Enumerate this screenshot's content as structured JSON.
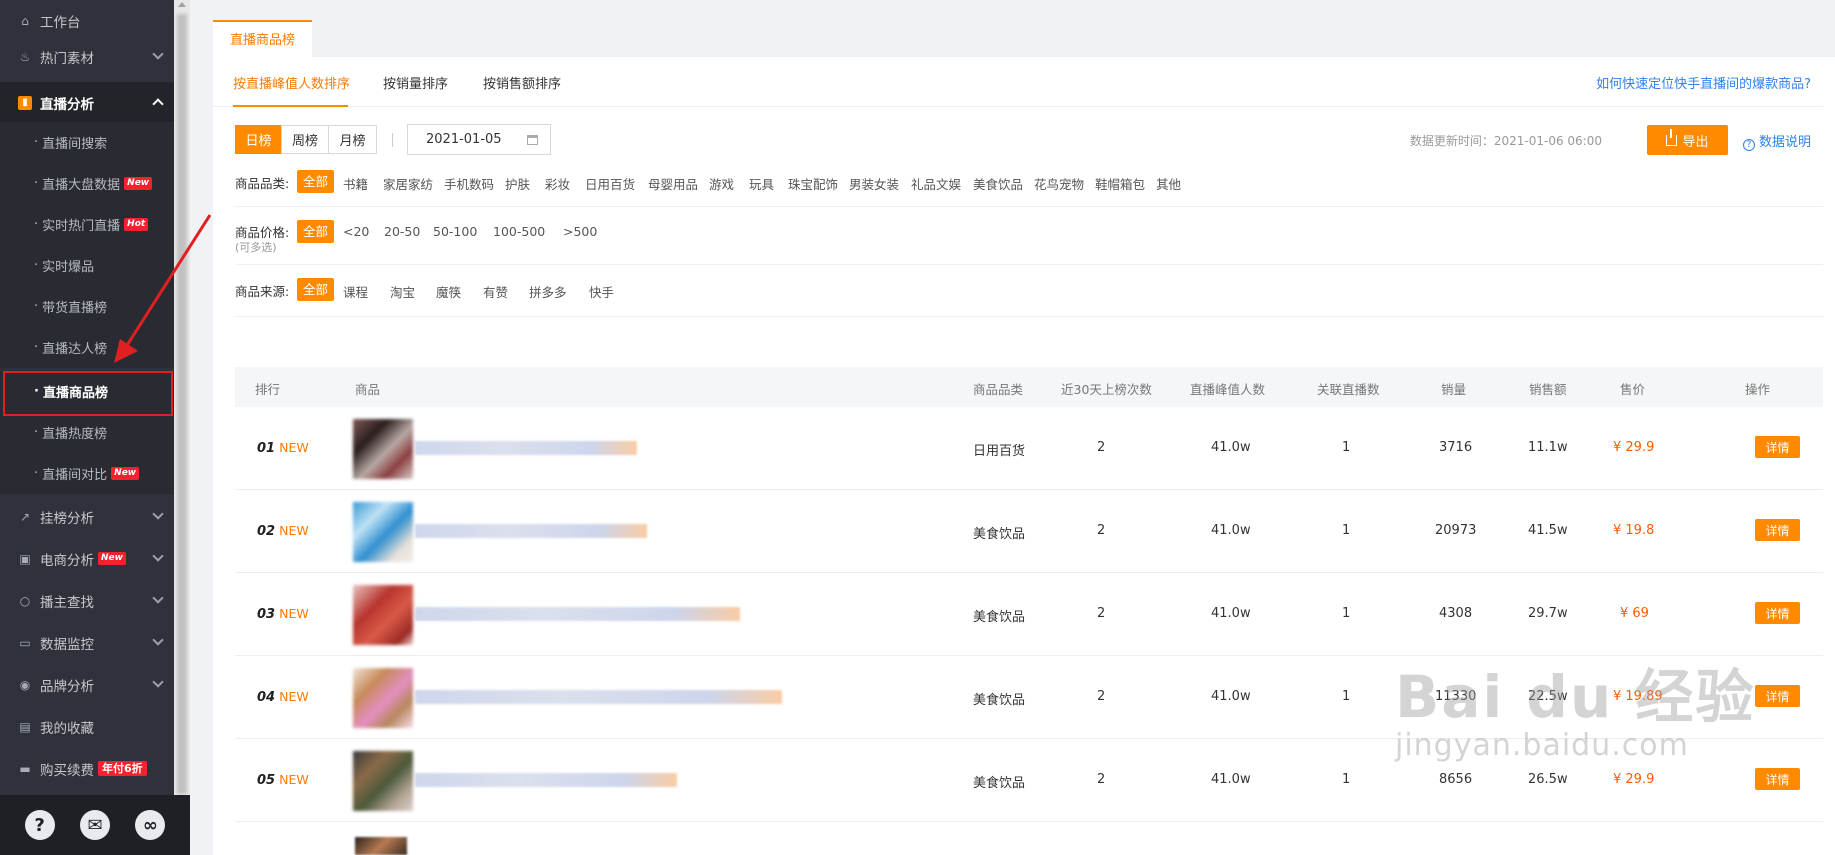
{
  "sidebar": {
    "items": [
      {
        "label": "工作台",
        "icon": "home-icon"
      },
      {
        "label": "热门素材",
        "icon": "fire-icon"
      },
      {
        "label": "直播分析",
        "icon": "bar-chart-icon"
      },
      {
        "label": "挂榜分析",
        "icon": "trend-icon"
      },
      {
        "label": "电商分析",
        "icon": "bag-icon",
        "tag": "New"
      },
      {
        "label": "播主查找",
        "icon": "search-icon"
      },
      {
        "label": "数据监控",
        "icon": "monitor-icon"
      },
      {
        "label": "品牌分析",
        "icon": "brand-icon"
      },
      {
        "label": "我的收藏",
        "icon": "collect-icon"
      },
      {
        "label": "购买续费",
        "icon": "card-icon",
        "tag": "年付6折"
      }
    ],
    "sub_items": [
      {
        "label": "直播间搜索"
      },
      {
        "label": "直播大盘数据",
        "tag": "New"
      },
      {
        "label": "实时热门直播",
        "tag": "Hot"
      },
      {
        "label": "实时爆品"
      },
      {
        "label": "带货直播榜"
      },
      {
        "label": "直播达人榜"
      },
      {
        "label": "直播商品榜"
      },
      {
        "label": "直播热度榜"
      },
      {
        "label": "直播间对比",
        "tag": "New"
      }
    ],
    "bottom_icons": [
      "help-icon",
      "wechat-icon",
      "link-icon"
    ],
    "bottom_glyphs": {
      "help": "?",
      "wechat": "✉",
      "link": "∞"
    }
  },
  "main": {
    "tab": "直播商品榜",
    "sort_tabs": [
      "按直播峰值人数排序",
      "按销量排序",
      "按销售额排序"
    ],
    "help_link": "如何快速定位快手直播间的爆款商品?",
    "periods": [
      "日榜",
      "周榜",
      "月榜"
    ],
    "date": "2021-01-05",
    "update_time": "数据更新时间：2021-01-06 06:00",
    "export_label": "导出",
    "data_desc": "数据说明",
    "filters": {
      "category": {
        "label": "商品品类:",
        "options": [
          "全部",
          "书籍",
          "家居家纺",
          "手机数码",
          "护肤",
          "彩妆",
          "日用百货",
          "母婴用品",
          "游戏",
          "玩具",
          "珠宝配饰",
          "男装女装",
          "礼品文娱",
          "美食饮品",
          "花鸟宠物",
          "鞋帽箱包",
          "其他"
        ]
      },
      "price": {
        "label": "商品价格:",
        "sub": "(可多选)",
        "options": [
          "全部",
          "<20",
          "20-50",
          "50-100",
          "100-500",
          ">500"
        ]
      },
      "source": {
        "label": "商品来源:",
        "options": [
          "全部",
          "课程",
          "淘宝",
          "魔筷",
          "有赞",
          "拼多多",
          "快手"
        ]
      }
    },
    "table": {
      "headers": [
        "排行",
        "商品",
        "商品品类",
        "近30天上榜次数",
        "直播峰值人数",
        "关联直播数",
        "销量",
        "销售额",
        "售价",
        "操作"
      ],
      "rows": [
        {
          "rank": "01",
          "badge": "NEW",
          "category": "日用百货",
          "times": "2",
          "peak": "41.0w",
          "live": "1",
          "sales": "3716",
          "revenue": "11.1w",
          "price": "¥ 29.9",
          "action": "详情"
        },
        {
          "rank": "02",
          "badge": "NEW",
          "category": "美食饮品",
          "times": "2",
          "peak": "41.0w",
          "live": "1",
          "sales": "20973",
          "revenue": "41.5w",
          "price": "¥ 19.8",
          "action": "详情"
        },
        {
          "rank": "03",
          "badge": "NEW",
          "category": "美食饮品",
          "times": "2",
          "peak": "41.0w",
          "live": "1",
          "sales": "4308",
          "revenue": "29.7w",
          "price": "¥ 69",
          "action": "详情"
        },
        {
          "rank": "04",
          "badge": "NEW",
          "category": "美食饮品",
          "times": "2",
          "peak": "41.0w",
          "live": "1",
          "sales": "11330",
          "revenue": "22.5w",
          "price": "¥ 19.89",
          "action": "详情"
        },
        {
          "rank": "05",
          "badge": "NEW",
          "category": "美食饮品",
          "times": "2",
          "peak": "41.0w",
          "live": "1",
          "sales": "8656",
          "revenue": "26.5w",
          "price": "¥ 29.9",
          "action": "详情"
        }
      ]
    }
  },
  "watermark": {
    "main": "Bai du 经验",
    "sub": "jingyan.baidu.com"
  },
  "colors": {
    "accent": "#ff8a00",
    "sidebar": "#30323b",
    "link": "#2f80ed",
    "annotation": "#e02020"
  }
}
